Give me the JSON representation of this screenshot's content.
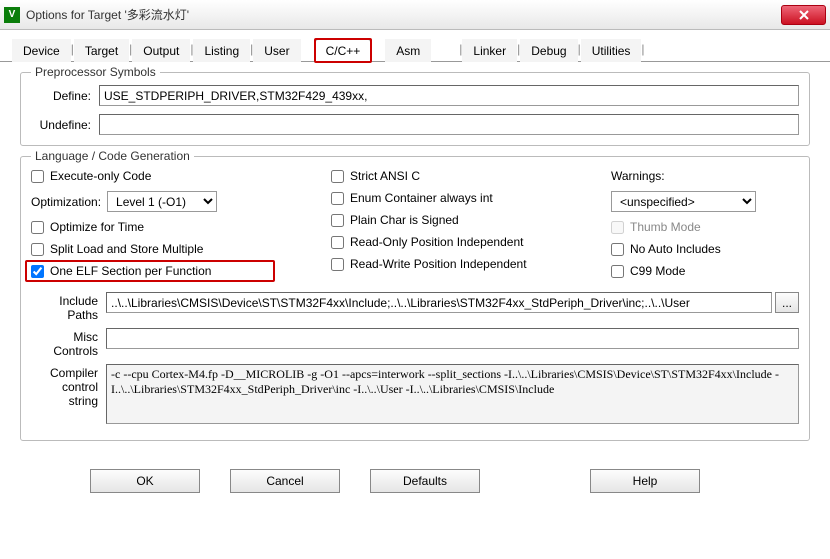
{
  "window": {
    "title": "Options for Target '多彩流水灯'"
  },
  "tabs": [
    "Device",
    "Target",
    "Output",
    "Listing",
    "User",
    "C/C++",
    "Asm",
    "Linker",
    "Debug",
    "Utilities"
  ],
  "active_tab": "C/C++",
  "preproc": {
    "group": "Preprocessor Symbols",
    "define_label": "Define:",
    "define_value": "USE_STDPERIPH_DRIVER,STM32F429_439xx,",
    "undefine_label": "Undefine:",
    "undefine_value": ""
  },
  "lang": {
    "group": "Language / Code Generation",
    "execute_only": "Execute-only Code",
    "optimization_label": "Optimization:",
    "optimization_value": "Level 1 (-O1)",
    "optimize_time": "Optimize for Time",
    "split_load": "Split Load and Store Multiple",
    "one_elf": "One ELF Section per Function",
    "strict_ansi": "Strict ANSI C",
    "enum_container": "Enum Container always int",
    "plain_char": "Plain Char is Signed",
    "ro_pos": "Read-Only Position Independent",
    "rw_pos": "Read-Write Position Independent",
    "warnings_label": "Warnings:",
    "warnings_value": "<unspecified>",
    "thumb": "Thumb Mode",
    "no_auto": "No Auto Includes",
    "c99": "C99 Mode"
  },
  "paths": {
    "include_label": "Include Paths",
    "include_value": "..\\..\\Libraries\\CMSIS\\Device\\ST\\STM32F4xx\\Include;..\\..\\Libraries\\STM32F4xx_StdPeriph_Driver\\inc;..\\..\\User",
    "misc_label": "Misc Controls",
    "misc_value": "",
    "compiler_label": "Compiler control string",
    "compiler_value": "-c --cpu Cortex-M4.fp -D__MICROLIB -g -O1 --apcs=interwork --split_sections -I..\\..\\Libraries\\CMSIS\\Device\\ST\\STM32F4xx\\Include -I..\\..\\Libraries\\STM32F4xx_StdPeriph_Driver\\inc -I..\\..\\User -I..\\..\\Libraries\\CMSIS\\Include"
  },
  "buttons": {
    "ok": "OK",
    "cancel": "Cancel",
    "defaults": "Defaults",
    "help": "Help"
  }
}
